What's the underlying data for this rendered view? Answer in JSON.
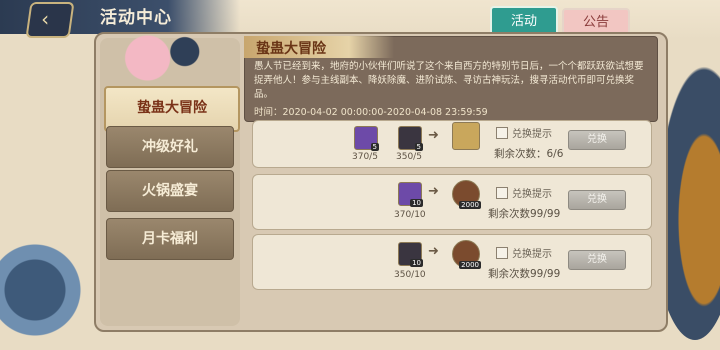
{
  "header": {
    "title": "活动中心",
    "back_icon": "back-icon"
  },
  "tabs": [
    {
      "label": "活动",
      "active": true
    },
    {
      "label": "公告",
      "active": false
    }
  ],
  "sidebar": {
    "items": [
      {
        "label": "蛰蛊大冒险",
        "active": true
      },
      {
        "label": "冲级好礼",
        "active": false
      },
      {
        "label": "火锅盛宴",
        "active": false
      },
      {
        "label": "月卡福利",
        "active": false
      }
    ]
  },
  "event": {
    "title": "蛰蛊大冒险",
    "description": "愚人节已经到来，地府的小伙伴们听说了这个来自西方的特别节日后，一个个都跃跃欲试想要捉弄他人！参与主线副本、降妖除魔、进阶试炼、寻访古神玩法，搜寻活动代币即可兑换奖品。",
    "time": "时间：2020-04-02 00:00:00-2020-04-08 23:59:59"
  },
  "rows": [
    {
      "costs": [
        {
          "count": "370/5",
          "badge": "5"
        },
        {
          "count": "350/5",
          "badge": "5"
        }
      ],
      "reward_badge": "",
      "check_label": "兑换提示",
      "remain": "剩余次数：6/6",
      "button": "兑换"
    },
    {
      "costs": [
        {
          "count": "370/10",
          "badge": "10"
        }
      ],
      "reward_badge": "2000",
      "check_label": "兑换提示",
      "remain": "剩余次数99/99",
      "button": "兑换"
    },
    {
      "costs": [
        {
          "count": "350/10",
          "badge": "10"
        }
      ],
      "reward_badge": "2000",
      "check_label": "兑换提示",
      "remain": "剩余次数99/99",
      "button": "兑换"
    }
  ]
}
